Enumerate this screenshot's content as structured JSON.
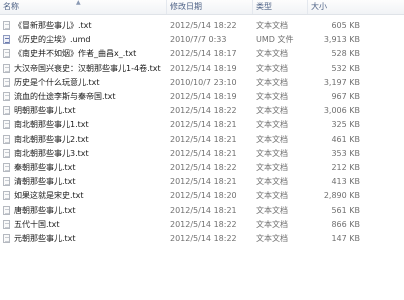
{
  "columns": {
    "name": "名称",
    "date": "修改日期",
    "type": "类型",
    "size": "大小"
  },
  "files": [
    {
      "name": "《冒新那些事儿》.txt",
      "date": "2012/5/14 18:22",
      "type": "文本文档",
      "size": "605 KB",
      "icon": "text-file-icon"
    },
    {
      "name": "《历史的尘埃》.umd",
      "date": "2010/7/7 0:33",
      "type": "UMD 文件",
      "size": "3,913 KB",
      "icon": "umd-file-icon"
    },
    {
      "name": "《南史并不如烟》作者_曲昌x_.txt",
      "date": "2012/5/14 18:17",
      "type": "文本文档",
      "size": "528 KB",
      "icon": "text-file-icon"
    },
    {
      "name": "大汉帝国兴衰史：汉朝那些事儿1-4卷.txt",
      "date": "2012/5/14 18:19",
      "type": "文本文档",
      "size": "532 KB",
      "icon": "text-file-icon"
    },
    {
      "name": "历史是个什么玩意儿.txt",
      "date": "2010/10/7 23:10",
      "type": "文本文档",
      "size": "3,197 KB",
      "icon": "text-file-icon"
    },
    {
      "name": "流血的仕途李斯与秦帝国.txt",
      "date": "2012/5/14 18:19",
      "type": "文本文档",
      "size": "967 KB",
      "icon": "text-file-icon"
    },
    {
      "name": "明朝那些事儿.txt",
      "date": "2012/5/14 18:22",
      "type": "文本文档",
      "size": "3,006 KB",
      "icon": "text-file-icon"
    },
    {
      "name": "南北朝那些事儿1.txt",
      "date": "2012/5/14 18:21",
      "type": "文本文档",
      "size": "325 KB",
      "icon": "text-file-icon"
    },
    {
      "name": "南北朝那些事儿2.txt",
      "date": "2012/5/14 18:21",
      "type": "文本文档",
      "size": "461 KB",
      "icon": "text-file-icon"
    },
    {
      "name": "南北朝那些事儿3.txt",
      "date": "2012/5/14 18:21",
      "type": "文本文档",
      "size": "353 KB",
      "icon": "text-file-icon"
    },
    {
      "name": "秦朝那些事儿.txt",
      "date": "2012/5/14 18:22",
      "type": "文本文档",
      "size": "212 KB",
      "icon": "text-file-icon"
    },
    {
      "name": "清朝那些事儿.txt",
      "date": "2012/5/14 18:21",
      "type": "文本文档",
      "size": "413 KB",
      "icon": "text-file-icon"
    },
    {
      "name": "如果这就是宋史.txt",
      "date": "2012/5/14 18:20",
      "type": "文本文档",
      "size": "2,890 KB",
      "icon": "text-file-icon"
    },
    {
      "name": "唐朝那些事儿.txt",
      "date": "2012/5/14 18:21",
      "type": "文本文档",
      "size": "561 KB",
      "icon": "text-file-icon"
    },
    {
      "name": "五代十国.txt",
      "date": "2012/5/14 18:22",
      "type": "文本文档",
      "size": "866 KB",
      "icon": "text-file-icon"
    },
    {
      "name": "元朝那些事儿.txt",
      "date": "2012/5/14 18:22",
      "type": "文本文档",
      "size": "147 KB",
      "icon": "text-file-icon"
    }
  ]
}
